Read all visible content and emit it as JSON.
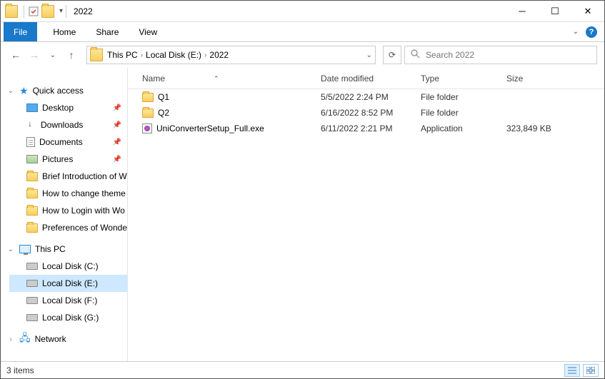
{
  "window": {
    "title": "2022"
  },
  "ribbon": {
    "file": "File",
    "home": "Home",
    "share": "Share",
    "view": "View"
  },
  "breadcrumbs": [
    "This PC",
    "Local Disk (E:)",
    "2022"
  ],
  "search": {
    "placeholder": "Search 2022"
  },
  "nav": {
    "quick_access": "Quick access",
    "quick_items": [
      {
        "label": "Desktop",
        "icon": "desktop",
        "pinned": true
      },
      {
        "label": "Downloads",
        "icon": "download",
        "pinned": true
      },
      {
        "label": "Documents",
        "icon": "doc",
        "pinned": true
      },
      {
        "label": "Pictures",
        "icon": "pic",
        "pinned": true
      },
      {
        "label": "Brief Introduction of W",
        "icon": "folder",
        "pinned": false
      },
      {
        "label": "How to change theme",
        "icon": "folder",
        "pinned": false
      },
      {
        "label": "How to Login with Wo",
        "icon": "folder",
        "pinned": false
      },
      {
        "label": "Preferences of Wonde",
        "icon": "folder",
        "pinned": false
      }
    ],
    "this_pc": "This PC",
    "drives": [
      {
        "label": "Local Disk (C:)",
        "selected": false
      },
      {
        "label": "Local Disk (E:)",
        "selected": true
      },
      {
        "label": "Local Disk (F:)",
        "selected": false
      },
      {
        "label": "Local Disk (G:)",
        "selected": false
      }
    ],
    "network": "Network"
  },
  "columns": {
    "name": "Name",
    "date": "Date modified",
    "type": "Type",
    "size": "Size"
  },
  "rows": [
    {
      "icon": "folder",
      "name": "Q1",
      "date": "5/5/2022 2:24 PM",
      "type": "File folder",
      "size": ""
    },
    {
      "icon": "folder",
      "name": "Q2",
      "date": "6/16/2022 8:52 PM",
      "type": "File folder",
      "size": ""
    },
    {
      "icon": "app",
      "name": "UniConverterSetup_Full.exe",
      "date": "6/11/2022 2:21 PM",
      "type": "Application",
      "size": "323,849 KB"
    }
  ],
  "status": {
    "count": "3 items"
  }
}
